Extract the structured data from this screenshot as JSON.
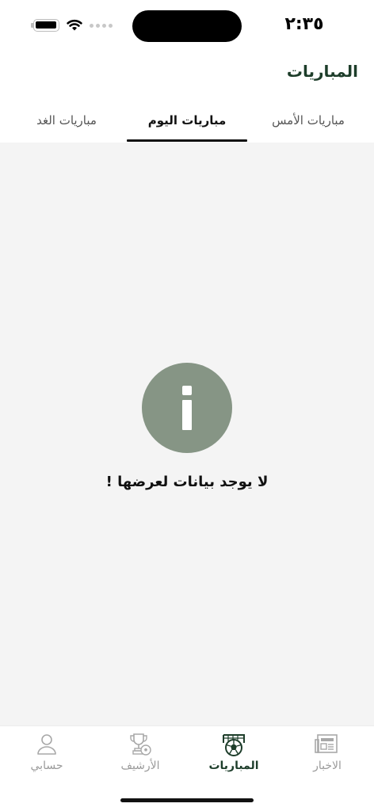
{
  "status_bar": {
    "time": "٢:٣٥"
  },
  "header": {
    "title": "المباريات"
  },
  "tabs": [
    {
      "label": "مباريات الأمس",
      "active": false
    },
    {
      "label": "مباريات اليوم",
      "active": true
    },
    {
      "label": "مباريات الغد",
      "active": false
    }
  ],
  "empty_state": {
    "icon": "info-icon",
    "message": "لا يوجد بيانات لعرضها !"
  },
  "bottom_nav": [
    {
      "label": "الاخبار",
      "icon": "newspaper-icon",
      "active": false
    },
    {
      "label": "المباريات",
      "icon": "soccer-goal-icon",
      "active": true
    },
    {
      "label": "الأرشيف",
      "icon": "trophy-icon",
      "active": false
    },
    {
      "label": "حسابي",
      "icon": "person-icon",
      "active": false
    }
  ],
  "colors": {
    "brand_green": "#1d3d2a",
    "info_circle": "#869585",
    "content_bg": "#f4f4f4",
    "inactive_text": "#9a9a9a"
  }
}
